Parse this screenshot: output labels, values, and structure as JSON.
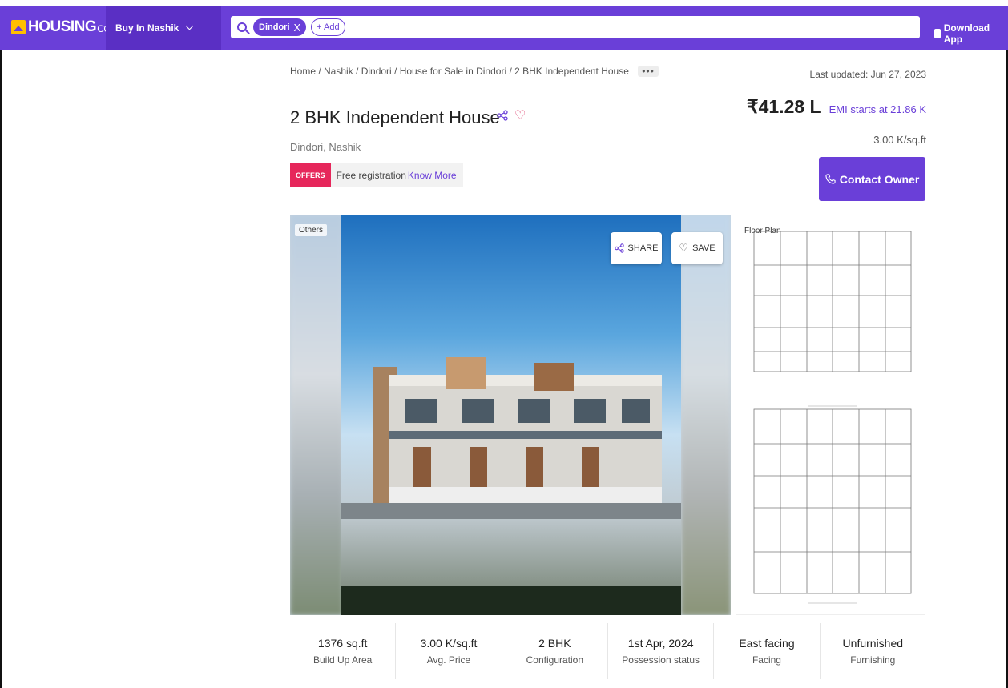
{
  "header": {
    "logo_text": "HOUSING",
    "logo_suffix": "COM",
    "city_label": "Buy In Nashik",
    "search_chip": "Dindori",
    "search_chip_close": "X",
    "add_chip": "+ Add",
    "download_label": "Download App",
    "brand_color": "#6a3fd8"
  },
  "breadcrumb": "Home / Nashik / Dindori / House for Sale in Dindori / 2 BHK Independent House",
  "breadcrumb_more": "•••",
  "last_updated": "Last updated: Jun 27, 2023",
  "property": {
    "title": "2 BHK Independent House",
    "location": "Dindori, Nashik",
    "price": "₹41.28 L",
    "emi": "EMI starts at 21.86 K",
    "price_per_sqft": "3.00 K/sq.ft"
  },
  "offer": {
    "badge": "OFFERS",
    "text": "Free registration",
    "link": "Know More"
  },
  "contact_label": "Contact Owner",
  "gallery": {
    "tag": "Others",
    "share_label": "SHARE",
    "save_label": "SAVE",
    "floor_plan_label": "Floor Plan"
  },
  "stats": [
    {
      "value": "1376 sq.ft",
      "label": "Build Up Area"
    },
    {
      "value": "3.00 K/sq.ft",
      "label": "Avg. Price"
    },
    {
      "value": "2 BHK",
      "label": "Configuration"
    },
    {
      "value": "1st Apr, 2024",
      "label": "Possession status"
    },
    {
      "value": "East facing",
      "label": "Facing"
    },
    {
      "value": "Unfurnished",
      "label": "Furnishing"
    }
  ]
}
